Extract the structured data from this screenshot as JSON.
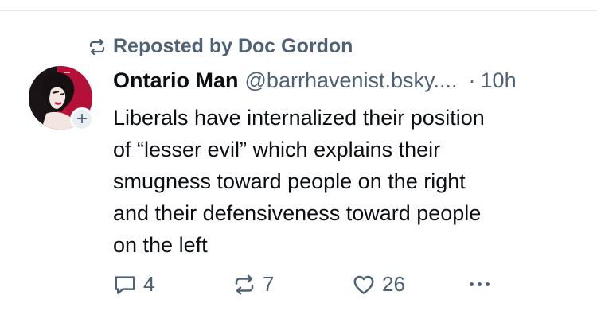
{
  "repost": {
    "label": "Reposted by Doc Gordon",
    "icon": "repost-icon"
  },
  "post": {
    "author_name": "Ontario Man",
    "author_handle": "@barrhavenist.bsky....",
    "separator": "·",
    "time": "10h",
    "text": "Liberals have internalized their position\nof “lesser evil” which explains their\nsmugness toward people on the right\nand their defensiveness toward people\non the left",
    "avatar_follow_symbol": "+"
  },
  "actions": {
    "reply_count": "4",
    "repost_count": "7",
    "like_count": "26",
    "icons": [
      "reply-icon",
      "repost-icon",
      "heart-icon",
      "more-icon"
    ]
  },
  "colors": {
    "text": "#0b0f14",
    "muted": "#4f6175",
    "divider": "#e3e7ec"
  }
}
